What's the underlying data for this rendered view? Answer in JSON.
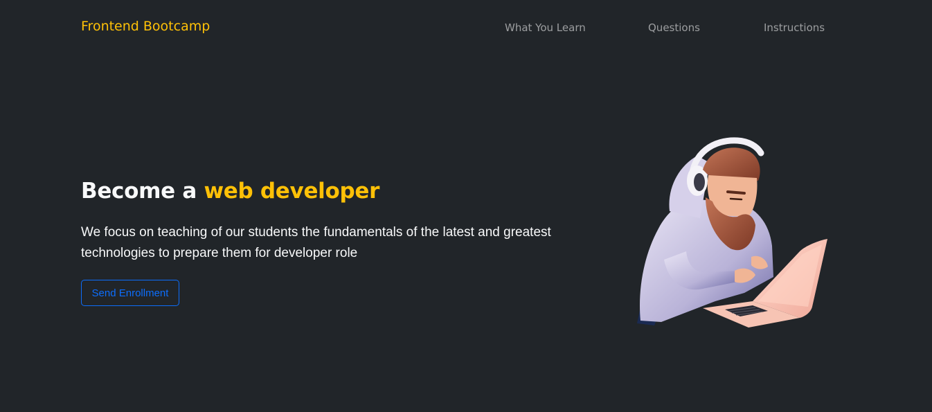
{
  "navbar": {
    "brand": "Frontend Bootcamp",
    "links": [
      {
        "label": "What You Learn"
      },
      {
        "label": "Questions"
      },
      {
        "label": "Instructions"
      }
    ]
  },
  "hero": {
    "title_prefix": "Become a ",
    "title_accent": "web developer",
    "lead": "We focus on teaching of our students the fundamentals of the latest and greatest technologies to prepare them for developer role",
    "cta_label": "Send Enrollment"
  },
  "colors": {
    "background": "#212529",
    "accent": "#ffc107",
    "primary": "#0d6efd",
    "text": "#f8f9fa"
  },
  "icons": {
    "hero_image": "developer-with-laptop-illustration"
  }
}
